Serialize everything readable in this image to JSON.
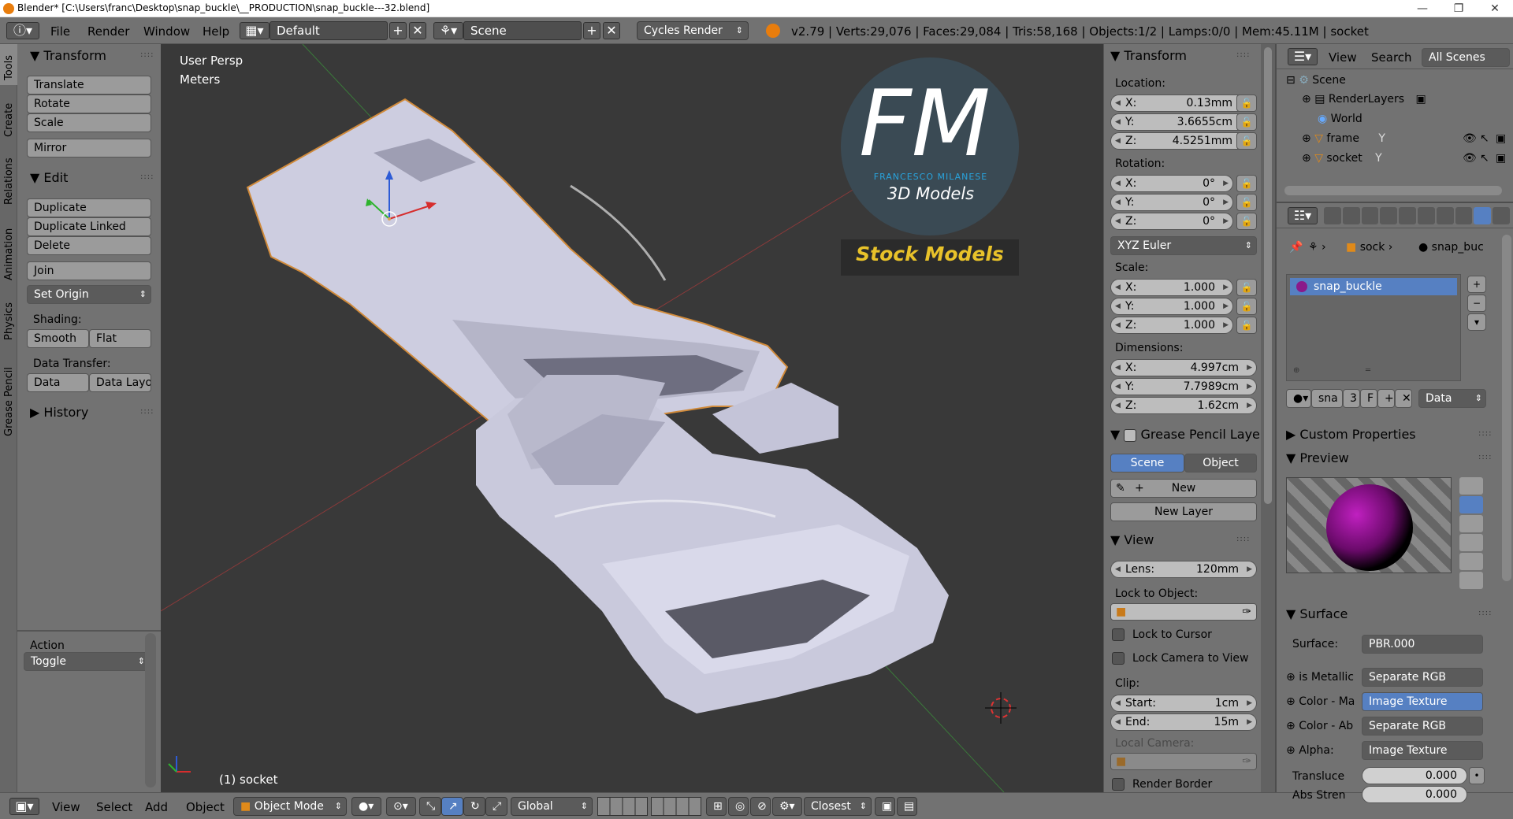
{
  "titlebar": {
    "title": "Blender* [C:\\Users\\franc\\Desktop\\snap_buckle\\__PRODUCTION\\snap_buckle---32.blend]",
    "minimize": "—",
    "restore": "❐",
    "close": "✕"
  },
  "topbar": {
    "menus": [
      "File",
      "Render",
      "Window",
      "Help"
    ],
    "layout_value": "Default",
    "scene_value": "Scene",
    "engine_value": "Cycles Render",
    "stats": "v2.79 | Verts:29,076 | Faces:29,084 | Tris:58,168 | Objects:1/2 | Lamps:0/0 | Mem:45.11M | socket"
  },
  "toolshelf": {
    "tabs": [
      "Tools",
      "Create",
      "Relations",
      "Animation",
      "Physics",
      "Grease Pencil"
    ],
    "transform_header": "Transform",
    "transform_buttons": [
      "Translate",
      "Rotate",
      "Scale"
    ],
    "mirror": "Mirror",
    "edit_header": "Edit",
    "edit_buttons": [
      "Duplicate",
      "Duplicate Linked",
      "Delete"
    ],
    "join": "Join",
    "set_origin": "Set Origin",
    "shading_label": "Shading:",
    "smooth": "Smooth",
    "flat": "Flat",
    "data_transfer_label": "Data Transfer:",
    "data": "Data",
    "data_layout": "Data Layo",
    "history_header": "History",
    "action_label": "Action",
    "action_value": "Toggle"
  },
  "viewport": {
    "view_name": "User Persp",
    "units": "Meters",
    "object_label": "(1) socket",
    "logo_letters": "FM",
    "logo_name": "FRANCESCO MILANESE",
    "logo_sub": "3D Models",
    "logo_banner": "Stock Models"
  },
  "properties_n": {
    "transform_header": "Transform",
    "location_label": "Location:",
    "location": [
      {
        "k": "X:",
        "v": "0.13mm"
      },
      {
        "k": "Y:",
        "v": "3.6655cm"
      },
      {
        "k": "Z:",
        "v": "4.5251mm"
      }
    ],
    "rotation_label": "Rotation:",
    "rotation": [
      {
        "k": "X:",
        "v": "0°"
      },
      {
        "k": "Y:",
        "v": "0°"
      },
      {
        "k": "Z:",
        "v": "0°"
      }
    ],
    "rotation_mode": "XYZ Euler",
    "scale_label": "Scale:",
    "scale": [
      {
        "k": "X:",
        "v": "1.000"
      },
      {
        "k": "Y:",
        "v": "1.000"
      },
      {
        "k": "Z:",
        "v": "1.000"
      }
    ],
    "dimensions_label": "Dimensions:",
    "dimensions": [
      {
        "k": "X:",
        "v": "4.997cm"
      },
      {
        "k": "Y:",
        "v": "7.7989cm"
      },
      {
        "k": "Z:",
        "v": "1.62cm"
      }
    ],
    "gp_header": "Grease Pencil Layer",
    "gp_scene": "Scene",
    "gp_object": "Object",
    "gp_new": "New",
    "gp_new_layer": "New Layer",
    "view_header": "View",
    "lens_key": "Lens:",
    "lens_val": "120mm",
    "lock_to_object": "Lock to Object:",
    "lock_to_cursor": "Lock to Cursor",
    "lock_camera": "Lock Camera to View",
    "clip_label": "Clip:",
    "clip_start_key": "Start:",
    "clip_start_val": "1cm",
    "clip_end_key": "End:",
    "clip_end_val": "15m",
    "local_camera": "Local Camera:",
    "render_border": "Render Border"
  },
  "outliner": {
    "view": "View",
    "search": "Search",
    "all_scenes": "All Scenes",
    "rows": [
      "Scene",
      "RenderLayers",
      "World",
      "frame",
      "socket"
    ]
  },
  "material": {
    "crumb_object": "sock",
    "crumb_material": "snap_buc",
    "slot_name": "snap_buckle",
    "mat_field": "sna",
    "users": "3",
    "fake": "F",
    "link": "Data",
    "custom_props": "Custom Properties",
    "preview": "Preview",
    "surface_header": "Surface",
    "surface_label": "Surface:",
    "surface_value": "PBR.000",
    "inputs": [
      {
        "label": "is Metallic",
        "value": "Separate RGB",
        "highlight": false
      },
      {
        "label": "Color - Ma",
        "value": "Image Texture",
        "highlight": true
      },
      {
        "label": "Color - Ab",
        "value": "Separate RGB",
        "highlight": false
      },
      {
        "label": "Alpha:",
        "value": "Image Texture",
        "highlight": false
      }
    ],
    "translucency_label": "Transluce",
    "translucency_value": "0.000",
    "abs_label": "Abs Stren",
    "abs_value": "0.000"
  },
  "bottombar": {
    "menus": [
      "View",
      "Select",
      "Add",
      "Object"
    ],
    "mode": "Object Mode",
    "orientation": "Global",
    "snap": "Closest"
  },
  "colors": {
    "panel": "#727272",
    "viewport": "#393939",
    "accent": "#5680c2",
    "logo_blue": "#29a3dc",
    "logo_gold": "#e8c22a"
  }
}
